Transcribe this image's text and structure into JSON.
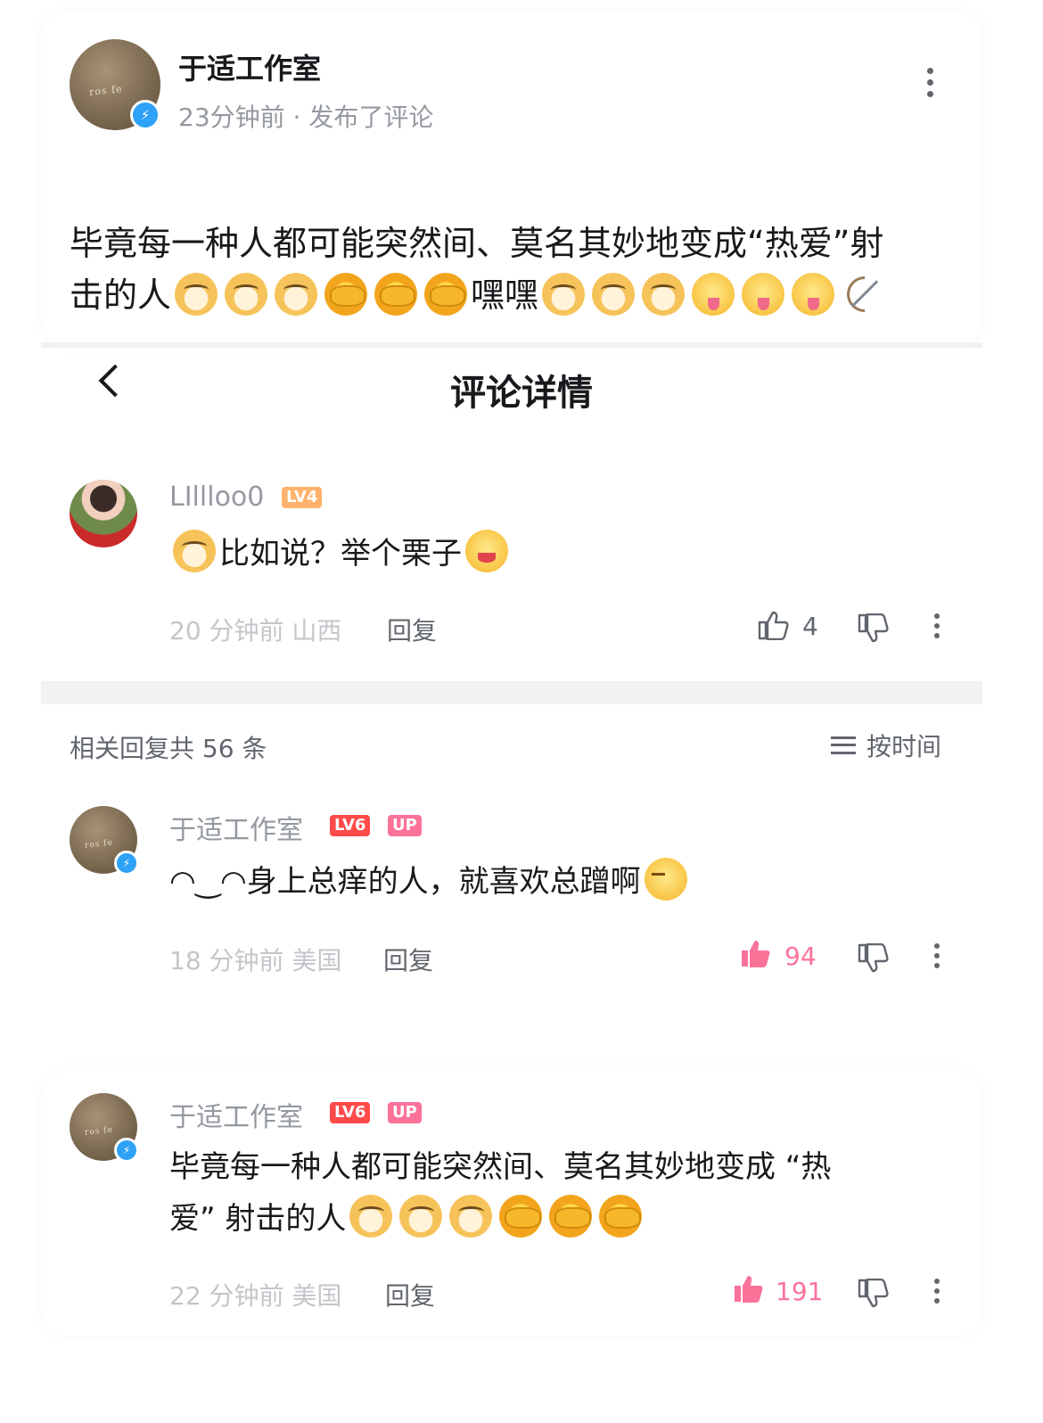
{
  "post": {
    "author": "于适工作室",
    "time_action": "23分钟前 · 发布了评论",
    "text_line1": "毕竟每一种人都可能突然间、莫名其妙地变成“热爱”射",
    "text_line2_a": "击的人",
    "text_line2_b": "嘿嘿",
    "emojis_group1": [
      "dog",
      "dog",
      "dog",
      "cover",
      "cover",
      "cover"
    ],
    "emojis_group2": [
      "dog",
      "dog",
      "dog",
      "tongue",
      "tongue",
      "tongue",
      "bow"
    ]
  },
  "header": {
    "title": "评论详情",
    "back_icon": "chevron-left-icon"
  },
  "root_comment": {
    "user": "LIllloo0",
    "level": "LV4",
    "text": "比如说？举个栗子",
    "emoji_prefix": "dog",
    "emoji_suffix": "face",
    "time_location": "20 分钟前 山西",
    "reply_label": "回复",
    "likes": "4"
  },
  "replies_header": {
    "total": "相关回复共 56 条",
    "sort_label": "按时间"
  },
  "replies": [
    {
      "user": "于适工作室",
      "level": "LV6",
      "up_badge": "UP",
      "text": "◠‿◠身上总痒的人，就喜欢总蹭啊",
      "emoji_suffix": "smirk",
      "time_location": "18 分钟前 美国",
      "reply_label": "回复",
      "likes": "94"
    },
    {
      "user": "于适工作室",
      "level": "LV6",
      "up_badge": "UP",
      "text_line1": "毕竟每一种人都可能突然间、莫名其妙地变成 “热",
      "text_line2": "爱” 射击的人",
      "time_location": "22 分钟前 美国",
      "reply_label": "回复",
      "likes": "191"
    }
  ],
  "colors": {
    "accent_pink": "#fb7299",
    "verify_blue": "#2ea2f7",
    "text_gray": "#9499a0",
    "lv6_red": "#ff4a4a",
    "lv4_orange": "#ffb26b"
  }
}
